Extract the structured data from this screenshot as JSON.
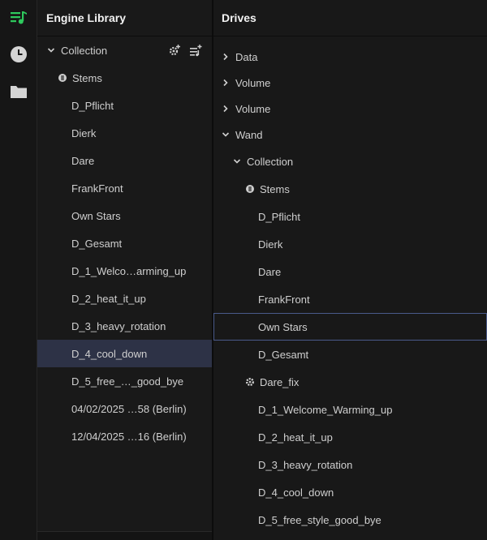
{
  "colors": {
    "accent": "#2ec95d",
    "selection": "#2d3246",
    "focus": "#4a5a8a"
  },
  "rail": {
    "items": [
      {
        "name": "playlists-icon"
      },
      {
        "name": "history-icon"
      },
      {
        "name": "folder-icon"
      }
    ]
  },
  "left": {
    "title": "Engine Library",
    "collection_label": "Collection",
    "items": [
      "Stems",
      "D_Pflicht",
      "Dierk",
      "Dare",
      "FrankFront",
      "Own Stars",
      "D_Gesamt",
      "D_1_Welco…arming_up",
      "D_2_heat_it_up",
      "D_3_heavy_rotation",
      "D_4_cool_down",
      "D_5_free_…_good_bye",
      "04/02/2025 …58 (Berlin)",
      "12/04/2025 …16 (Berlin)"
    ],
    "selected_index": 10
  },
  "right": {
    "title": "Drives",
    "drives": [
      "Data",
      "Volume",
      "Volume",
      "Wand"
    ],
    "collection_label": "Collection",
    "items": [
      "Stems",
      "D_Pflicht",
      "Dierk",
      "Dare",
      "FrankFront",
      "Own Stars",
      "D_Gesamt",
      "Dare_fix",
      "D_1_Welcome_Warming_up",
      "D_2_heat_it_up",
      "D_3_heavy_rotation",
      "D_4_cool_down",
      "D_5_free_style_good_bye"
    ],
    "focused_index": 5
  }
}
